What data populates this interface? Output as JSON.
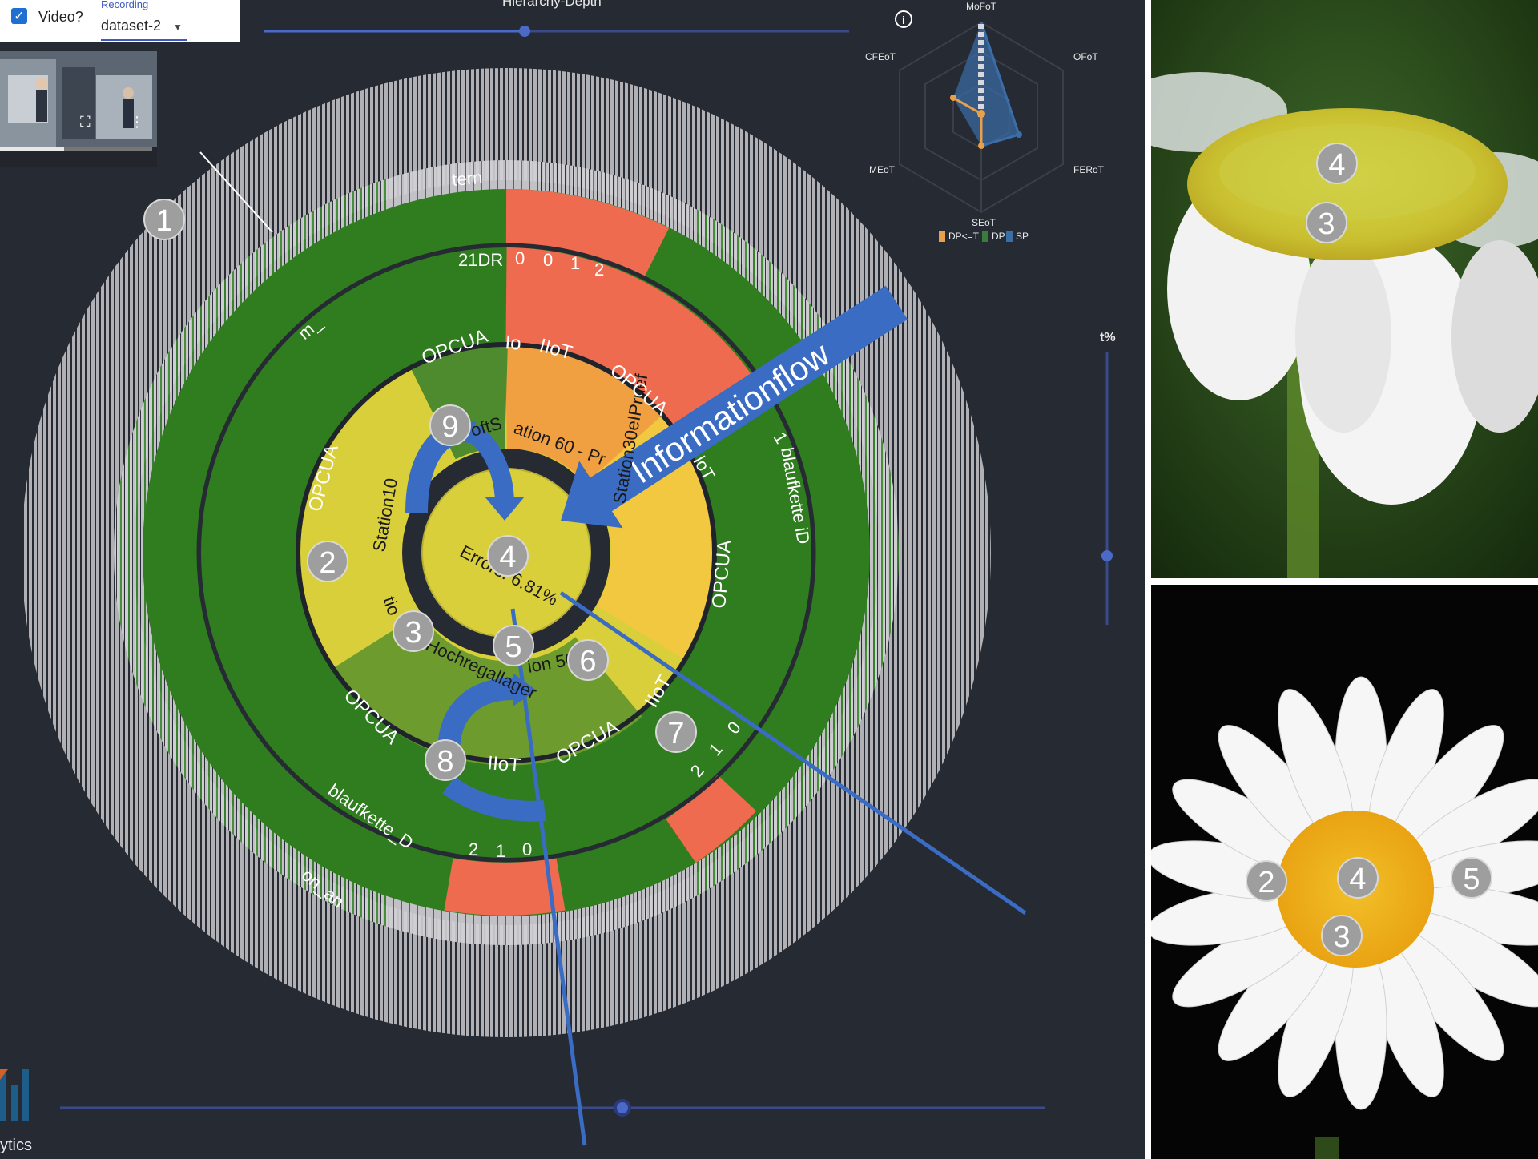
{
  "controls": {
    "video_label": "Video?",
    "recording_label": "Recording",
    "recording_value": "dataset-2",
    "hierarchy_label": "Hierarchy-Depth",
    "threshold_label": "t%"
  },
  "radar": {
    "axes": [
      "MoFoT",
      "OFoT",
      "FERoT",
      "SEoT",
      "MEoT",
      "CFEoT"
    ],
    "legend": [
      "DP<=T",
      "DP",
      "SP"
    ],
    "colors": {
      "dp_le_t": "#e8a04a",
      "dp": "#3a7d3a",
      "sp": "#3a6ea8"
    }
  },
  "sunburst": {
    "center_text": "Errors: 6.81%",
    "arrow_text": "Informationflow",
    "ring1_labels": [
      "Station10",
      "ation 60 - Pr",
      "Station30eIPruef",
      "Hochregallager",
      "ion 50",
      "tio",
      "oftS"
    ],
    "ring2_labels": [
      "OPCUA",
      "OPCUA",
      "OPCUA",
      "OPCUA",
      "OPCUA",
      "OPCUA",
      "IIoT",
      "IIoT",
      "IIoT",
      "Io",
      "loT"
    ],
    "ring3_labels": [
      "21DR",
      "0",
      "0",
      "1",
      "2",
      "blaufkette iD",
      "1",
      "2",
      "1",
      "0",
      "2",
      "1",
      "0",
      "blaufkette_D",
      "on_an",
      "m_",
      "tern"
    ]
  },
  "markers": {
    "main": [
      "1",
      "2",
      "3",
      "4",
      "5",
      "6",
      "7",
      "8",
      "9"
    ],
    "daisy_top": [
      "4",
      "3"
    ],
    "daisy_bottom": [
      "2",
      "4",
      "5",
      "3"
    ]
  },
  "logo_text": "ytics",
  "colors": {
    "background": "#262a33",
    "green": "#2f7d1f",
    "red": "#ee6b50",
    "yellow": "#d9cf3a",
    "olive": "#6e9b2e",
    "orange": "#f0a040",
    "gray_ring": "#c8c8cc",
    "accent_blue": "#3a6cc4"
  }
}
